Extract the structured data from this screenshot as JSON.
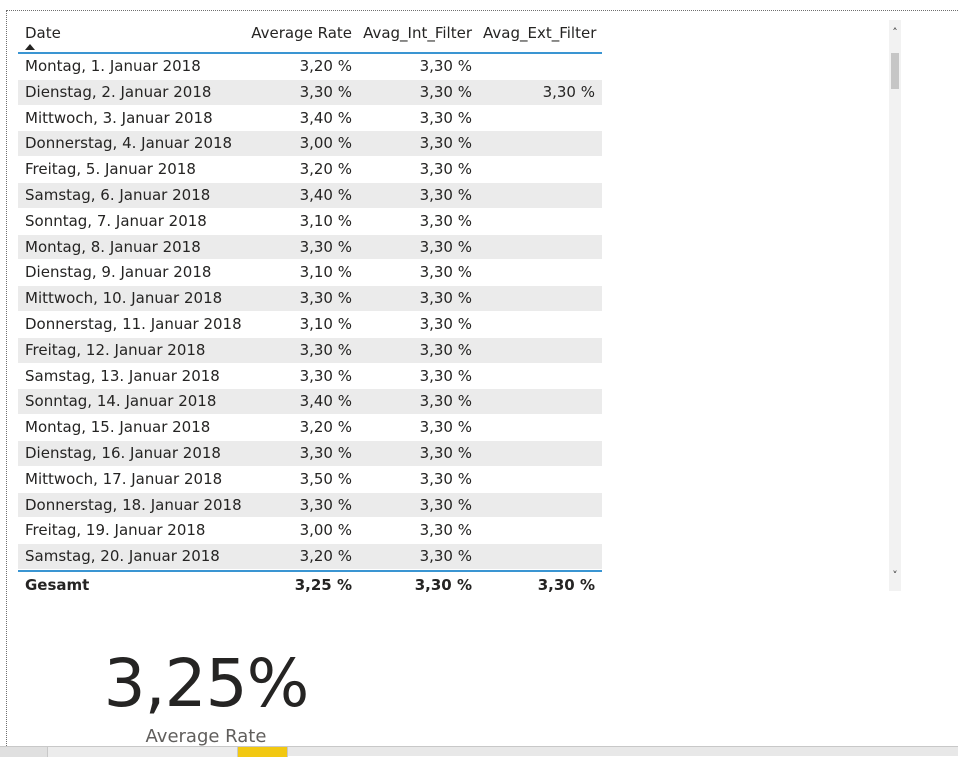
{
  "table": {
    "columns": [
      "Date",
      "Average Rate",
      "Avag_Int_Filter",
      "Avag_Ext_Filter"
    ],
    "rows": [
      {
        "date": "Montag, 1. Januar 2018",
        "avg": "3,20 %",
        "int": "3,30 %",
        "ext": ""
      },
      {
        "date": "Dienstag, 2. Januar 2018",
        "avg": "3,30 %",
        "int": "3,30 %",
        "ext": "3,30 %"
      },
      {
        "date": "Mittwoch, 3. Januar 2018",
        "avg": "3,40 %",
        "int": "3,30 %",
        "ext": ""
      },
      {
        "date": "Donnerstag, 4. Januar 2018",
        "avg": "3,00 %",
        "int": "3,30 %",
        "ext": ""
      },
      {
        "date": "Freitag, 5. Januar 2018",
        "avg": "3,20 %",
        "int": "3,30 %",
        "ext": ""
      },
      {
        "date": "Samstag, 6. Januar 2018",
        "avg": "3,40 %",
        "int": "3,30 %",
        "ext": ""
      },
      {
        "date": "Sonntag, 7. Januar 2018",
        "avg": "3,10 %",
        "int": "3,30 %",
        "ext": ""
      },
      {
        "date": "Montag, 8. Januar 2018",
        "avg": "3,30 %",
        "int": "3,30 %",
        "ext": ""
      },
      {
        "date": "Dienstag, 9. Januar 2018",
        "avg": "3,10 %",
        "int": "3,30 %",
        "ext": ""
      },
      {
        "date": "Mittwoch, 10. Januar 2018",
        "avg": "3,30 %",
        "int": "3,30 %",
        "ext": ""
      },
      {
        "date": "Donnerstag, 11. Januar 2018",
        "avg": "3,10 %",
        "int": "3,30 %",
        "ext": ""
      },
      {
        "date": "Freitag, 12. Januar 2018",
        "avg": "3,30 %",
        "int": "3,30 %",
        "ext": ""
      },
      {
        "date": "Samstag, 13. Januar 2018",
        "avg": "3,30 %",
        "int": "3,30 %",
        "ext": ""
      },
      {
        "date": "Sonntag, 14. Januar 2018",
        "avg": "3,40 %",
        "int": "3,30 %",
        "ext": ""
      },
      {
        "date": "Montag, 15. Januar 2018",
        "avg": "3,20 %",
        "int": "3,30 %",
        "ext": ""
      },
      {
        "date": "Dienstag, 16. Januar 2018",
        "avg": "3,30 %",
        "int": "3,30 %",
        "ext": ""
      },
      {
        "date": "Mittwoch, 17. Januar 2018",
        "avg": "3,50 %",
        "int": "3,30 %",
        "ext": ""
      },
      {
        "date": "Donnerstag, 18. Januar 2018",
        "avg": "3,30 %",
        "int": "3,30 %",
        "ext": ""
      },
      {
        "date": "Freitag, 19. Januar 2018",
        "avg": "3,00 %",
        "int": "3,30 %",
        "ext": ""
      },
      {
        "date": "Samstag, 20. Januar 2018",
        "avg": "3,20 %",
        "int": "3,30 %",
        "ext": ""
      }
    ],
    "total": {
      "label": "Gesamt",
      "avg": "3,25 %",
      "int": "3,30 %",
      "ext": "3,30 %"
    },
    "sort_icon": "sort-ascending-icon",
    "accent_color": "#3a95d2",
    "stripe_color": "#ebebeb"
  },
  "scrollbar": {
    "up_glyph": "˄",
    "down_glyph": "˅",
    "position": 0.0
  },
  "card": {
    "value": "3,25%",
    "label": "Average Rate"
  },
  "page_tabs": {
    "active_color": "#f2c811"
  }
}
